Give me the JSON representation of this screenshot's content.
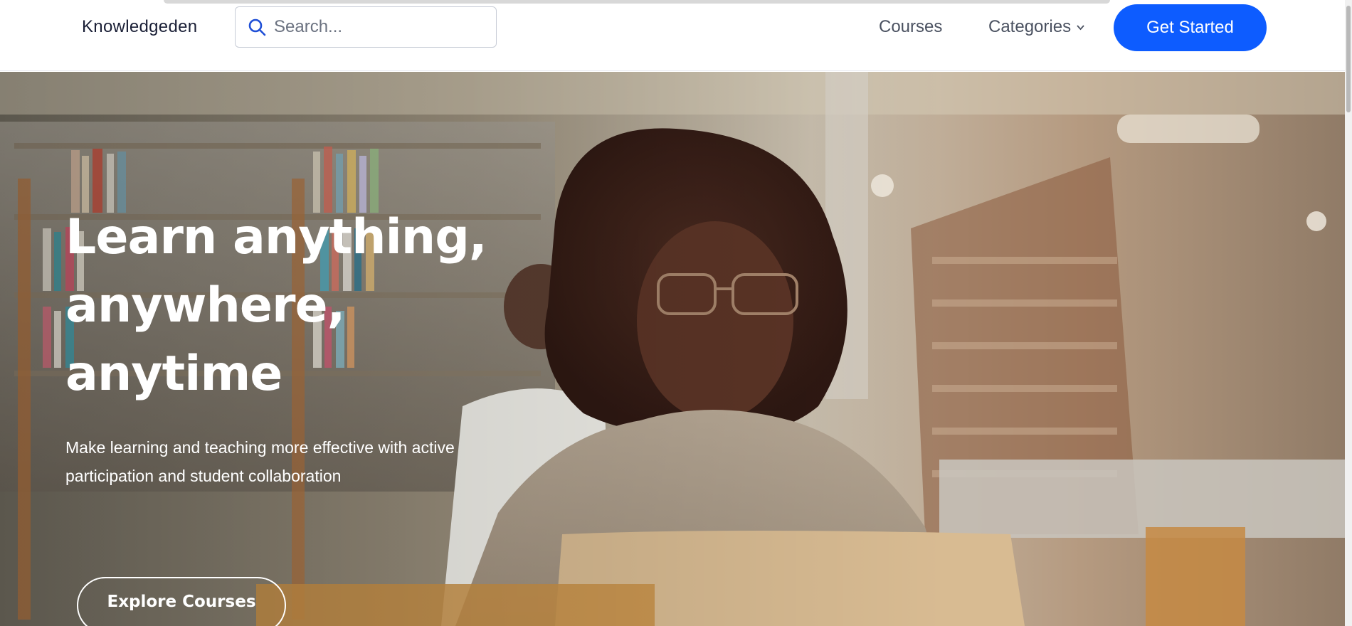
{
  "header": {
    "logo": "Knowledgeden",
    "search": {
      "placeholder": "Search...",
      "value": "",
      "icon": "search-icon"
    },
    "nav": {
      "courses": "Courses",
      "categories": "Categories",
      "categories_icon": "chevron-down-icon"
    },
    "cta_label": "Get Started"
  },
  "hero": {
    "title_lines": [
      "Learn anything,",
      "anywhere,",
      "anytime"
    ],
    "subtitle": "Make learning and teaching more effective with active participation and student collaboration",
    "button_label": "Explore Courses",
    "image": "library-student-laptop-photo"
  },
  "colors": {
    "brand_blue": "#0d5cff",
    "text_dark": "#1a1f36",
    "nav_text": "#4a5160",
    "hero_text": "#ffffff"
  }
}
